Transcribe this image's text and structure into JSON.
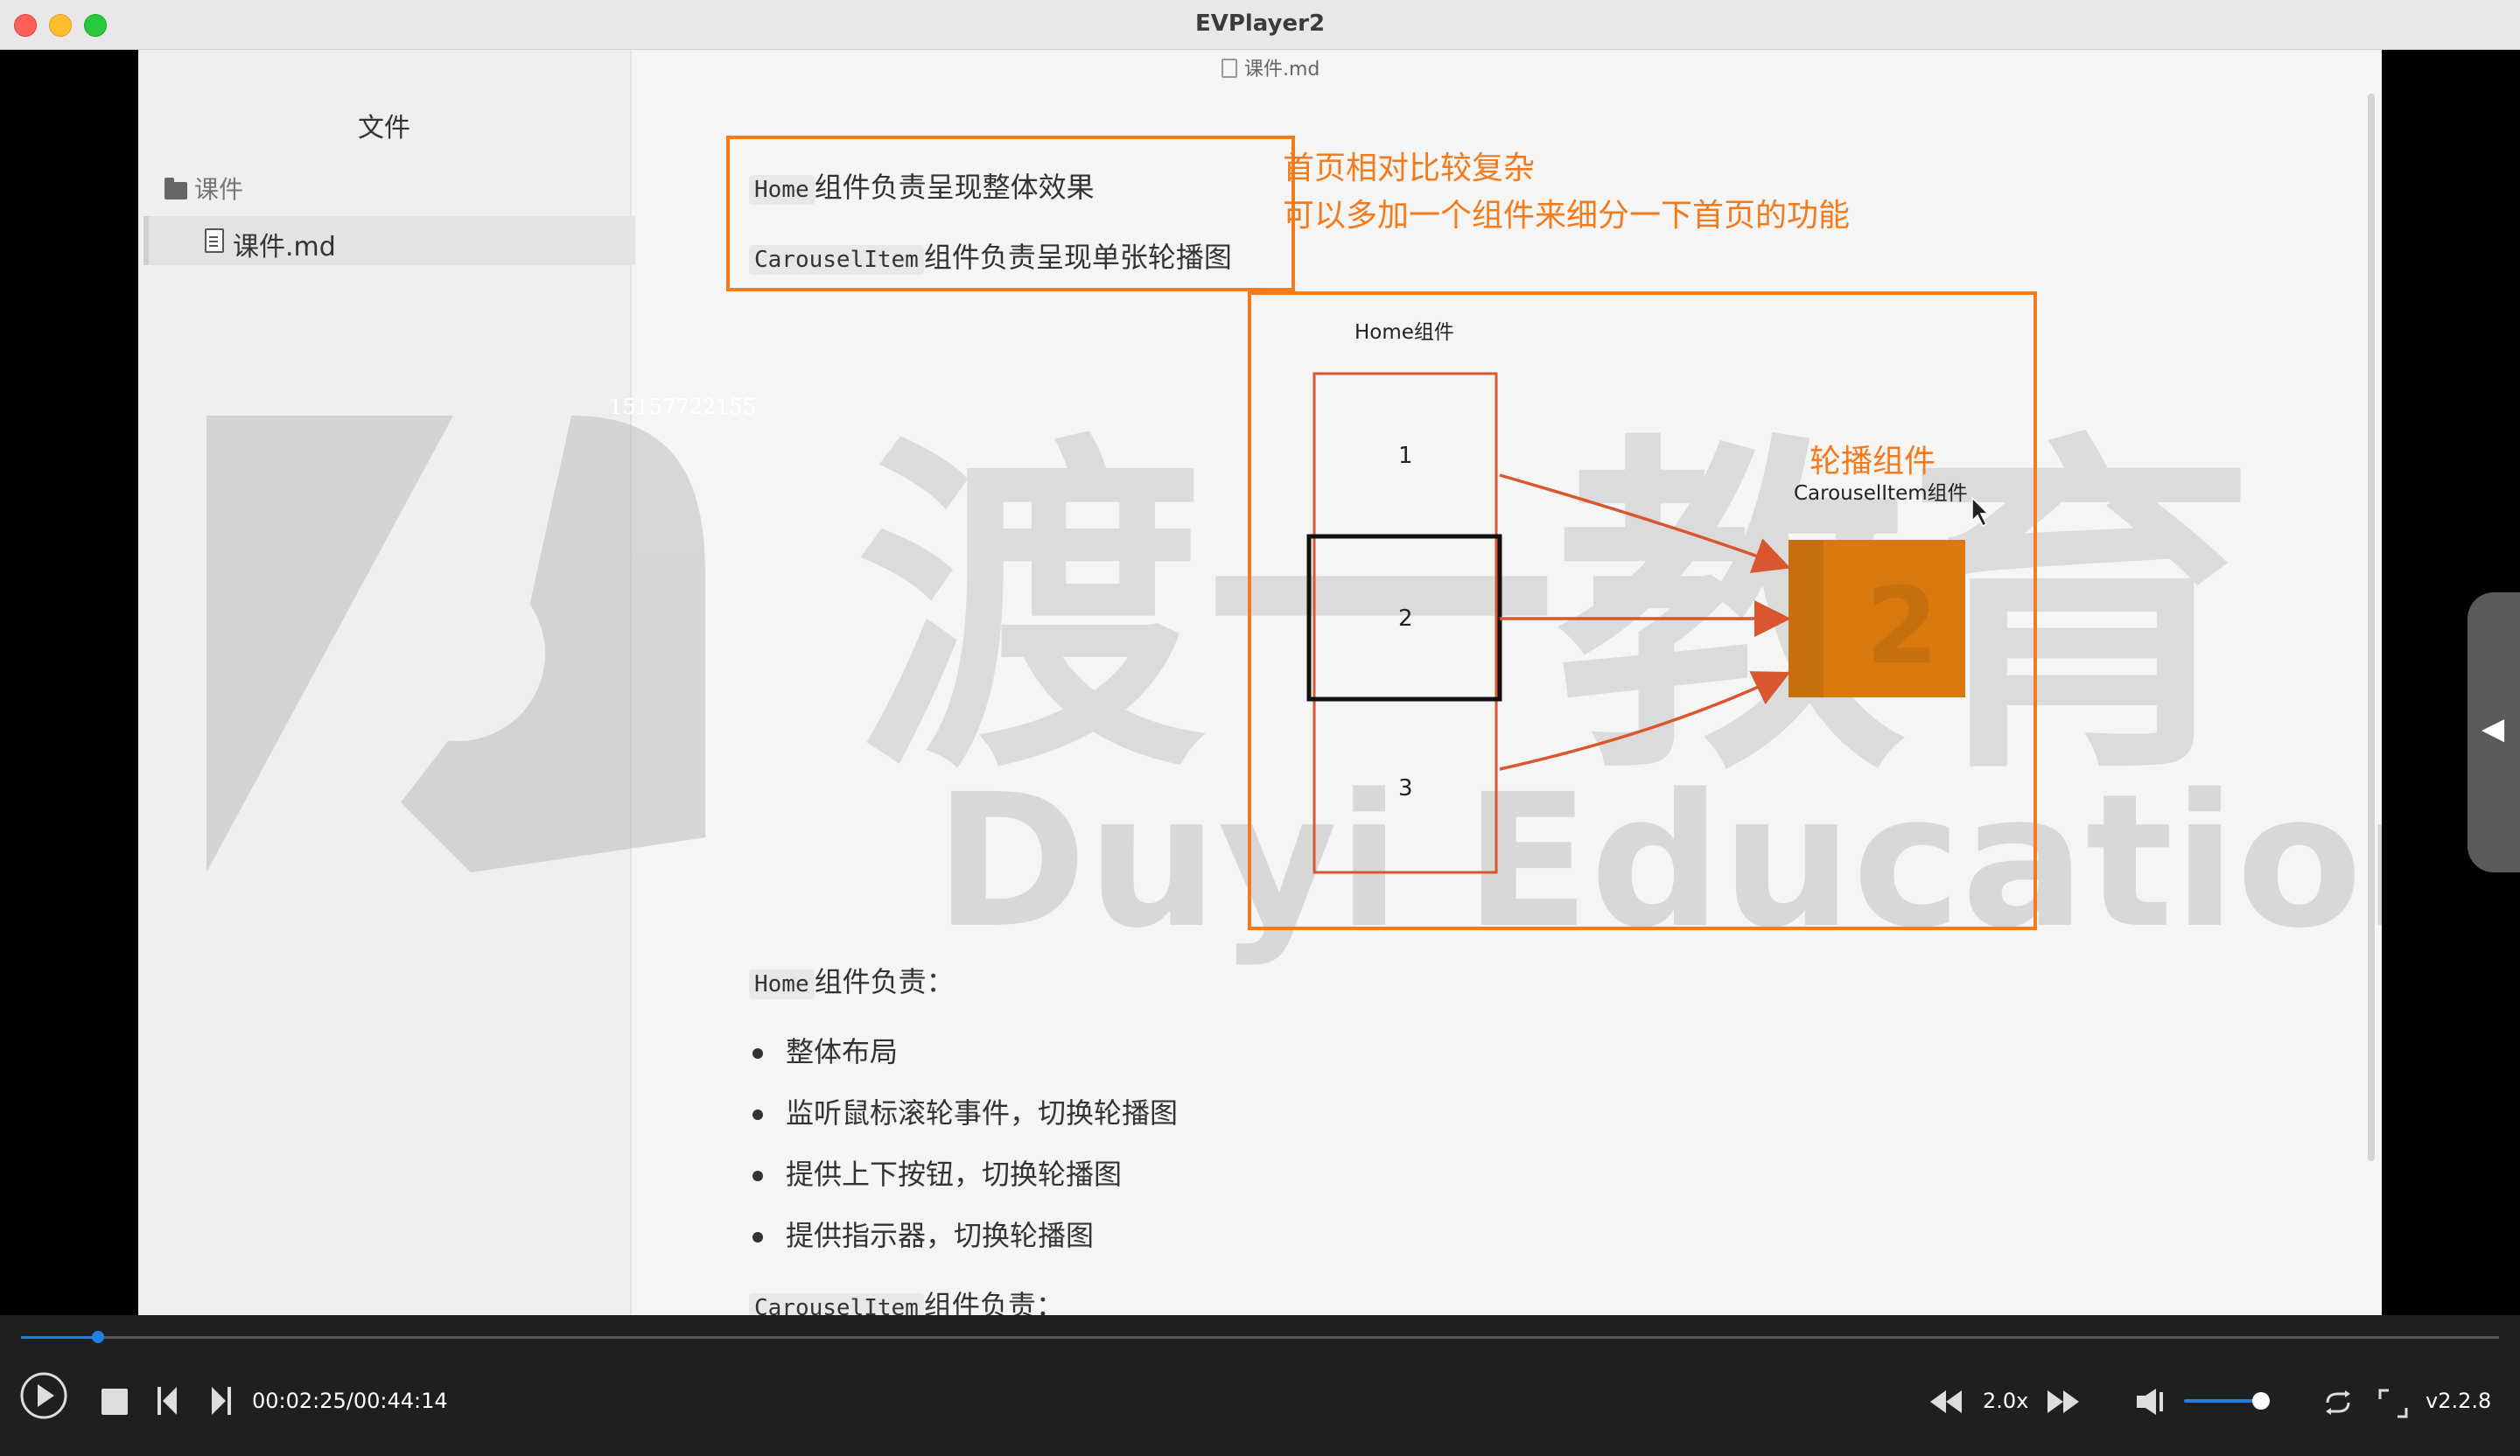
{
  "app": {
    "title": "EVPlayer2"
  },
  "document": {
    "tab_title": "课件.md"
  },
  "sidebar": {
    "heading": "文件",
    "folder_label": "课件",
    "file_label": "课件.md"
  },
  "watermark": {
    "brand_text": "渡一教育",
    "brand_en": "Duyi Education",
    "phone": "15157722155"
  },
  "content": {
    "top_box": {
      "line1_code": "Home",
      "line1_text": "组件负责呈现整体效果",
      "line2_code": "CarouselItem",
      "line2_text": "组件负责呈现单张轮播图"
    },
    "annotation": {
      "line1": "首页相对比较复杂",
      "line2": "可以多加一个组件来细分一下首页的功能"
    },
    "diagram": {
      "home_label": "Home组件",
      "items": [
        "1",
        "2",
        "3"
      ],
      "carousel_title_cn": "轮播组件",
      "carousel_label": "CarouselItem组件",
      "carousel_box_text": "2"
    },
    "home_section": {
      "heading_code": "Home",
      "heading_text": "组件负责：",
      "bullets": [
        "整体布局",
        "监听鼠标滚轮事件，切换轮播图",
        "提供上下按钮，切换轮播图",
        "提供指示器，切换轮播图"
      ]
    },
    "carousel_section": {
      "heading_code": "CarouselItem",
      "heading_text": "组件负责："
    }
  },
  "player": {
    "time": "00:02:25/00:44:14",
    "progress": 0.0312,
    "speed": "2.0x",
    "version": "v2.2.8",
    "volume": 0.85,
    "colors": {
      "accent": "#1e7fe8",
      "annotation": "#f47b1c"
    },
    "icons": [
      "play-icon",
      "stop-icon",
      "previous-icon",
      "next-icon",
      "rewind-icon",
      "fast-forward-icon",
      "volume-icon",
      "loop-icon",
      "fullscreen-icon",
      "side-panel-arrow-icon"
    ]
  }
}
